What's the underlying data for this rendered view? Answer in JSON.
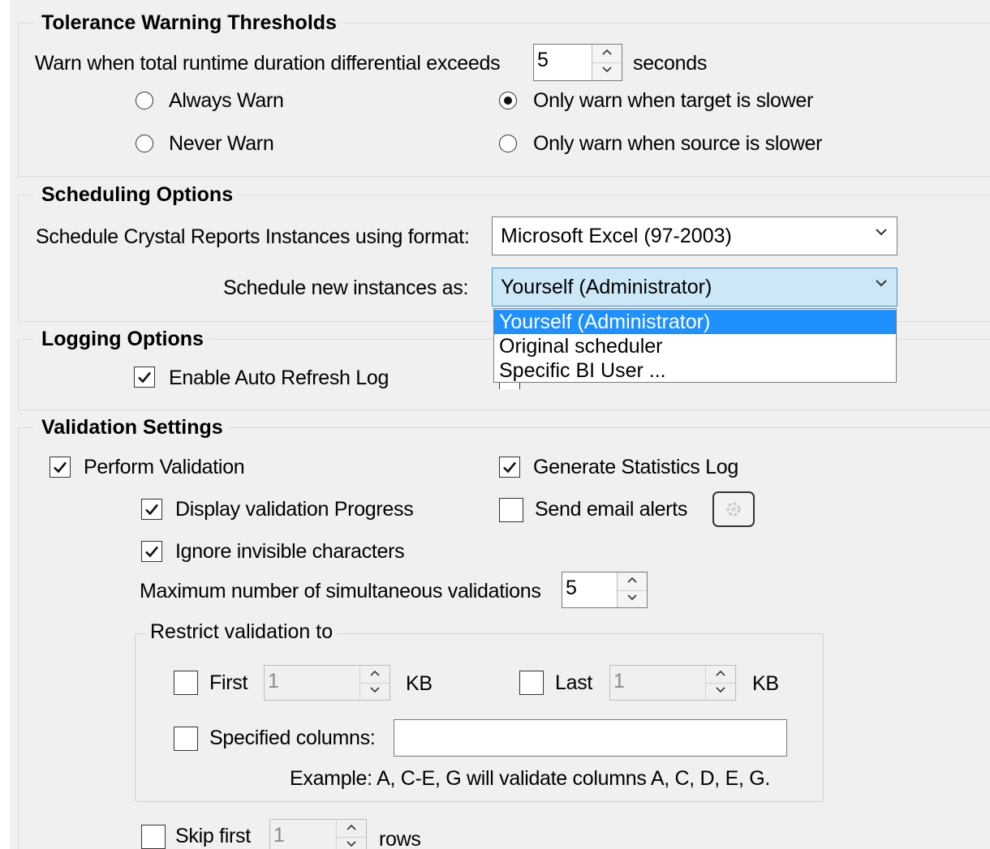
{
  "tolerance": {
    "title": "Tolerance Warning Thresholds",
    "warn_label": "Warn when total runtime duration differential exceeds",
    "warn_value": "5",
    "warn_unit": "seconds",
    "options": {
      "always_warn": "Always Warn",
      "never_warn": "Never Warn",
      "target_slower": "Only warn when target is slower",
      "source_slower": "Only warn when source is slower"
    },
    "selected": "target_slower"
  },
  "scheduling": {
    "title": "Scheduling Options",
    "format_label": "Schedule Crystal Reports Instances using format:",
    "format_value": "Microsoft Excel (97-2003)",
    "instances_label": "Schedule new instances as:",
    "instances_value": "Yourself (Administrator)",
    "instances_options": [
      "Yourself (Administrator)",
      "Original scheduler",
      "Specific BI User ..."
    ],
    "instances_highlighted": "Yourself (Administrator)"
  },
  "logging": {
    "title": "Logging Options",
    "auto_refresh_label": "Enable Auto Refresh Log",
    "auto_refresh_checked": true
  },
  "validation": {
    "title": "Validation Settings",
    "perform_label": "Perform Validation",
    "perform_checked": true,
    "stats_log_label": "Generate Statistics Log",
    "stats_log_checked": true,
    "display_progress_label": "Display validation Progress",
    "display_progress_checked": true,
    "email_alerts_label": "Send email alerts",
    "email_alerts_checked": false,
    "ignore_invisible_label": "Ignore invisible characters",
    "ignore_invisible_checked": true,
    "max_simultaneous_label": "Maximum number of simultaneous validations",
    "max_simultaneous_value": "5",
    "restrict": {
      "title": "Restrict validation to",
      "first_label": "First",
      "first_value": "1",
      "first_unit": "KB",
      "last_label": "Last",
      "last_value": "1",
      "last_unit": "KB",
      "columns_label": "Specified columns:",
      "columns_value": "",
      "example": "Example: A, C-E, G will validate columns A, C, D, E, G."
    },
    "skip_first_label": "Skip first",
    "skip_first_value": "1",
    "skip_first_unit": "rows"
  }
}
